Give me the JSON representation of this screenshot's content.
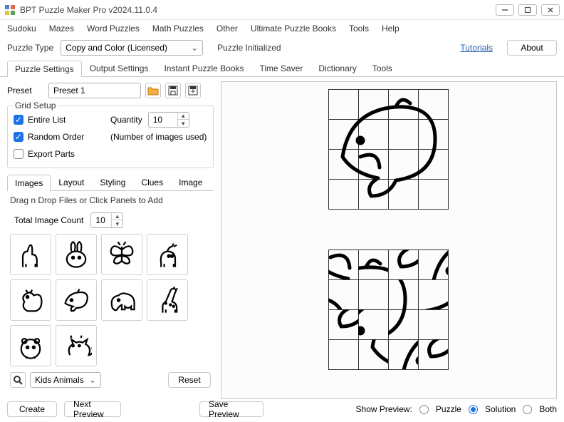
{
  "window": {
    "title": "BPT Puzzle Maker Pro v2024.11.0.4"
  },
  "menu": [
    "Sudoku",
    "Mazes",
    "Word Puzzles",
    "Math Puzzles",
    "Other",
    "Ultimate Puzzle Books",
    "Tools",
    "Help"
  ],
  "toolbar": {
    "puzzleTypeLabel": "Puzzle Type",
    "puzzleTypeValue": "Copy and Color (Licensed)",
    "status": "Puzzle Initialized",
    "tutorials": "Tutorials",
    "about": "About"
  },
  "tabs": {
    "items": [
      "Puzzle Settings",
      "Output Settings",
      "Instant Puzzle Books",
      "Time Saver",
      "Dictionary",
      "Tools"
    ],
    "active": 0
  },
  "preset": {
    "label": "Preset",
    "value": "Preset 1"
  },
  "gridSetup": {
    "legend": "Grid Setup",
    "entireList": "Entire List",
    "randomOrder": "Random Order",
    "exportParts": "Export Parts",
    "quantityLabel": "Quantity",
    "quantityValue": "10",
    "note": "(Number of images used)"
  },
  "subtabs": {
    "items": [
      "Images",
      "Layout",
      "Styling",
      "Clues",
      "Image"
    ],
    "active": 0
  },
  "images": {
    "hint": "Drag n Drop Files or Click Panels to Add",
    "totalLabel": "Total Image Count",
    "totalValue": "10",
    "thumbs": [
      "llama",
      "bunny",
      "butterfly",
      "deer",
      "squirrel",
      "dolphin",
      "elephant",
      "giraffe",
      "hamster",
      "cat"
    ],
    "collection": "Kids Animals",
    "reset": "Reset"
  },
  "footer": {
    "create": "Create",
    "nextPreview": "Next Preview",
    "savePreview": "Save Preview",
    "showPreview": "Show Preview:",
    "optPuzzle": "Puzzle",
    "optSolution": "Solution",
    "optBoth": "Both"
  }
}
